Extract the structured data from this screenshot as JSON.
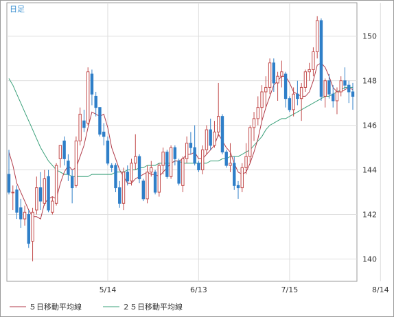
{
  "period_label": "日足",
  "legend": [
    {
      "label": "５日移動平均線",
      "color": "#b03a48"
    },
    {
      "label": "２５日移動平均線",
      "color": "#3aa07a"
    }
  ],
  "colors": {
    "up": "#c24b4b",
    "down": "#2f7fc8",
    "grid": "#dddddd",
    "frame": "#999999"
  },
  "chart_data": {
    "type": "candlestick",
    "ylim": [
      139,
      151.5
    ],
    "yticks": [
      140,
      142,
      144,
      146,
      148,
      150
    ],
    "xticks": [
      {
        "index": 25,
        "label": "5/14"
      },
      {
        "index": 48,
        "label": "6/13"
      },
      {
        "index": 71,
        "label": "7/15"
      },
      {
        "index": 94,
        "label": "8/14"
      }
    ],
    "candles": [
      [
        143.8,
        144.9,
        142.9,
        143.0
      ],
      [
        143.0,
        143.3,
        142.2,
        143.0
      ],
      [
        143.1,
        143.3,
        141.8,
        142.1
      ],
      [
        142.3,
        142.7,
        141.4,
        141.8
      ],
      [
        141.8,
        142.4,
        141.5,
        142.1
      ],
      [
        142.0,
        142.2,
        140.5,
        140.7
      ],
      [
        140.8,
        142.3,
        139.9,
        142.1
      ],
      [
        142.2,
        143.7,
        142.0,
        143.2
      ],
      [
        143.2,
        143.9,
        142.2,
        142.6
      ],
      [
        142.5,
        144.0,
        142.4,
        143.6
      ],
      [
        143.7,
        144.0,
        142.1,
        142.2
      ],
      [
        142.1,
        142.8,
        142.0,
        142.6
      ],
      [
        142.5,
        144.3,
        142.4,
        144.2
      ],
      [
        144.5,
        145.1,
        144.1,
        145.1
      ],
      [
        145.3,
        145.5,
        144.2,
        144.5
      ],
      [
        144.4,
        144.7,
        143.5,
        143.8
      ],
      [
        143.7,
        144.0,
        142.5,
        143.2
      ],
      [
        143.3,
        145.5,
        143.2,
        145.3
      ],
      [
        145.3,
        146.8,
        145.1,
        146.5
      ],
      [
        146.2,
        146.7,
        145.7,
        145.9
      ],
      [
        146.1,
        148.6,
        146.0,
        148.4
      ],
      [
        148.3,
        148.5,
        146.9,
        147.4
      ],
      [
        147.3,
        147.5,
        146.4,
        146.8
      ],
      [
        146.8,
        146.8,
        145.5,
        145.6
      ],
      [
        145.7,
        146.1,
        145.1,
        145.5
      ],
      [
        145.3,
        145.5,
        144.2,
        144.3
      ],
      [
        144.2,
        144.3,
        143.9,
        144.1
      ],
      [
        144.2,
        144.3,
        143.0,
        143.2
      ],
      [
        143.2,
        143.5,
        142.3,
        142.5
      ],
      [
        142.5,
        144.1,
        142.2,
        143.9
      ],
      [
        143.9,
        144.2,
        143.3,
        143.5
      ],
      [
        143.5,
        144.5,
        143.3,
        144.3
      ],
      [
        144.3,
        145.6,
        144.0,
        144.6
      ],
      [
        144.6,
        144.7,
        143.4,
        143.6
      ],
      [
        143.5,
        143.6,
        142.6,
        142.7
      ],
      [
        142.7,
        144.2,
        142.5,
        143.9
      ],
      [
        143.9,
        144.4,
        143.7,
        144.1
      ],
      [
        143.9,
        144.0,
        142.9,
        143.0
      ],
      [
        143.0,
        144.3,
        142.8,
        144.2
      ],
      [
        144.2,
        145.0,
        143.8,
        144.8
      ],
      [
        144.8,
        144.9,
        143.6,
        143.7
      ],
      [
        143.7,
        145.1,
        143.6,
        145.0
      ],
      [
        145.0,
        145.1,
        144.2,
        144.5
      ],
      [
        144.4,
        144.5,
        143.3,
        143.4
      ],
      [
        143.3,
        144.6,
        143.0,
        144.5
      ],
      [
        144.5,
        145.5,
        144.3,
        145.2
      ],
      [
        145.2,
        145.7,
        144.7,
        145.0
      ],
      [
        145.0,
        146.0,
        144.2,
        144.3
      ],
      [
        144.3,
        144.4,
        143.9,
        144.0
      ],
      [
        144.0,
        145.1,
        143.8,
        144.9
      ],
      [
        144.9,
        146.0,
        144.7,
        145.8
      ],
      [
        145.8,
        146.3,
        144.9,
        145.1
      ],
      [
        145.1,
        146.2,
        145.0,
        145.7
      ],
      [
        145.7,
        147.9,
        145.5,
        146.4
      ],
      [
        146.4,
        146.5,
        144.7,
        144.8
      ],
      [
        144.8,
        144.9,
        144.1,
        144.2
      ],
      [
        144.2,
        145.2,
        143.9,
        144.3
      ],
      [
        144.3,
        144.6,
        143.1,
        143.3
      ],
      [
        143.3,
        143.5,
        142.7,
        143.2
      ],
      [
        143.2,
        144.3,
        143.0,
        144.1
      ],
      [
        144.1,
        145.2,
        143.8,
        144.6
      ],
      [
        144.6,
        146.0,
        144.3,
        145.9
      ],
      [
        145.9,
        146.6,
        145.3,
        146.3
      ],
      [
        146.3,
        147.3,
        146.0,
        146.8
      ],
      [
        146.8,
        147.8,
        146.2,
        147.5
      ],
      [
        147.5,
        148.2,
        146.8,
        147.7
      ],
      [
        147.7,
        149.0,
        147.4,
        148.8
      ],
      [
        148.8,
        149.0,
        147.5,
        147.9
      ],
      [
        147.9,
        148.4,
        147.1,
        148.2
      ],
      [
        148.2,
        148.9,
        147.7,
        148.4
      ],
      [
        148.3,
        148.4,
        146.8,
        147.2
      ],
      [
        147.2,
        147.3,
        146.6,
        146.7
      ],
      [
        146.7,
        147.7,
        146.4,
        147.4
      ],
      [
        147.4,
        148.0,
        146.9,
        147.2
      ],
      [
        147.2,
        147.9,
        146.2,
        147.7
      ],
      [
        147.7,
        148.5,
        147.5,
        148.4
      ],
      [
        148.4,
        148.8,
        148.0,
        148.5
      ],
      [
        148.5,
        149.5,
        148.2,
        149.3
      ],
      [
        149.3,
        150.9,
        149.0,
        150.7
      ],
      [
        150.7,
        150.8,
        147.1,
        147.3
      ],
      [
        147.3,
        148.1,
        146.8,
        148.0
      ],
      [
        148.0,
        148.3,
        147.2,
        147.4
      ],
      [
        147.4,
        147.8,
        146.8,
        147.1
      ],
      [
        147.1,
        147.7,
        146.5,
        147.5
      ],
      [
        147.5,
        148.2,
        147.3,
        148.0
      ],
      [
        148.0,
        148.6,
        147.6,
        147.8
      ],
      [
        147.8,
        148.0,
        147.0,
        147.5
      ],
      [
        147.5,
        147.9,
        146.7,
        147.3
      ]
    ],
    "ma5": [
      144.8,
      144.2,
      143.4,
      143.0,
      142.6,
      142.2,
      141.9,
      141.9,
      141.8,
      142.5,
      142.7,
      142.8,
      142.7,
      143.4,
      143.9,
      144.2,
      144.0,
      144.1,
      144.6,
      145.1,
      145.9,
      146.6,
      146.5,
      146.4,
      146.5,
      145.9,
      145.0,
      144.5,
      144.0,
      143.7,
      143.4,
      143.4,
      143.6,
      143.7,
      143.8,
      143.9,
      143.8,
      143.8,
      143.7,
      143.9,
      144.1,
      144.3,
      144.4,
      144.4,
      144.5,
      144.7,
      144.7,
      144.8,
      144.5,
      144.5,
      144.7,
      144.9,
      145.1,
      145.6,
      145.3,
      145.0,
      144.8,
      144.3,
      143.9,
      143.8,
      143.9,
      144.3,
      144.8,
      145.4,
      146.2,
      146.8,
      147.3,
      147.8,
      148.0,
      148.2,
      148.2,
      147.9,
      147.5,
      147.4,
      147.3,
      147.3,
      147.5,
      148.0,
      148.7,
      148.8,
      148.6,
      148.2,
      147.7,
      147.5,
      147.5,
      147.6,
      147.7,
      147.6
    ],
    "ma25": [
      148.1,
      147.8,
      147.4,
      147.0,
      146.6,
      146.2,
      145.8,
      145.4,
      145.0,
      144.7,
      144.4,
      144.2,
      144.0,
      143.9,
      143.8,
      143.8,
      143.7,
      143.7,
      143.7,
      143.7,
      143.7,
      143.8,
      143.8,
      143.8,
      143.8,
      143.8,
      143.8,
      143.9,
      143.9,
      143.9,
      144.0,
      144.0,
      144.0,
      144.1,
      144.1,
      144.2,
      144.2,
      144.2,
      144.3,
      144.3,
      144.3,
      144.3,
      144.4,
      144.4,
      144.3,
      144.3,
      144.3,
      144.3,
      144.3,
      144.3,
      144.3,
      144.4,
      144.4,
      144.4,
      144.5,
      144.5,
      144.6,
      144.6,
      144.6,
      144.7,
      144.8,
      144.9,
      145.1,
      145.3,
      145.5,
      145.8,
      146.0,
      146.1,
      146.2,
      146.3,
      146.3,
      146.4,
      146.5,
      146.6,
      146.7,
      146.8,
      146.9,
      147.0,
      147.1,
      147.2,
      147.3,
      147.3,
      147.4,
      147.5,
      147.6,
      147.7,
      147.7,
      147.7
    ]
  }
}
